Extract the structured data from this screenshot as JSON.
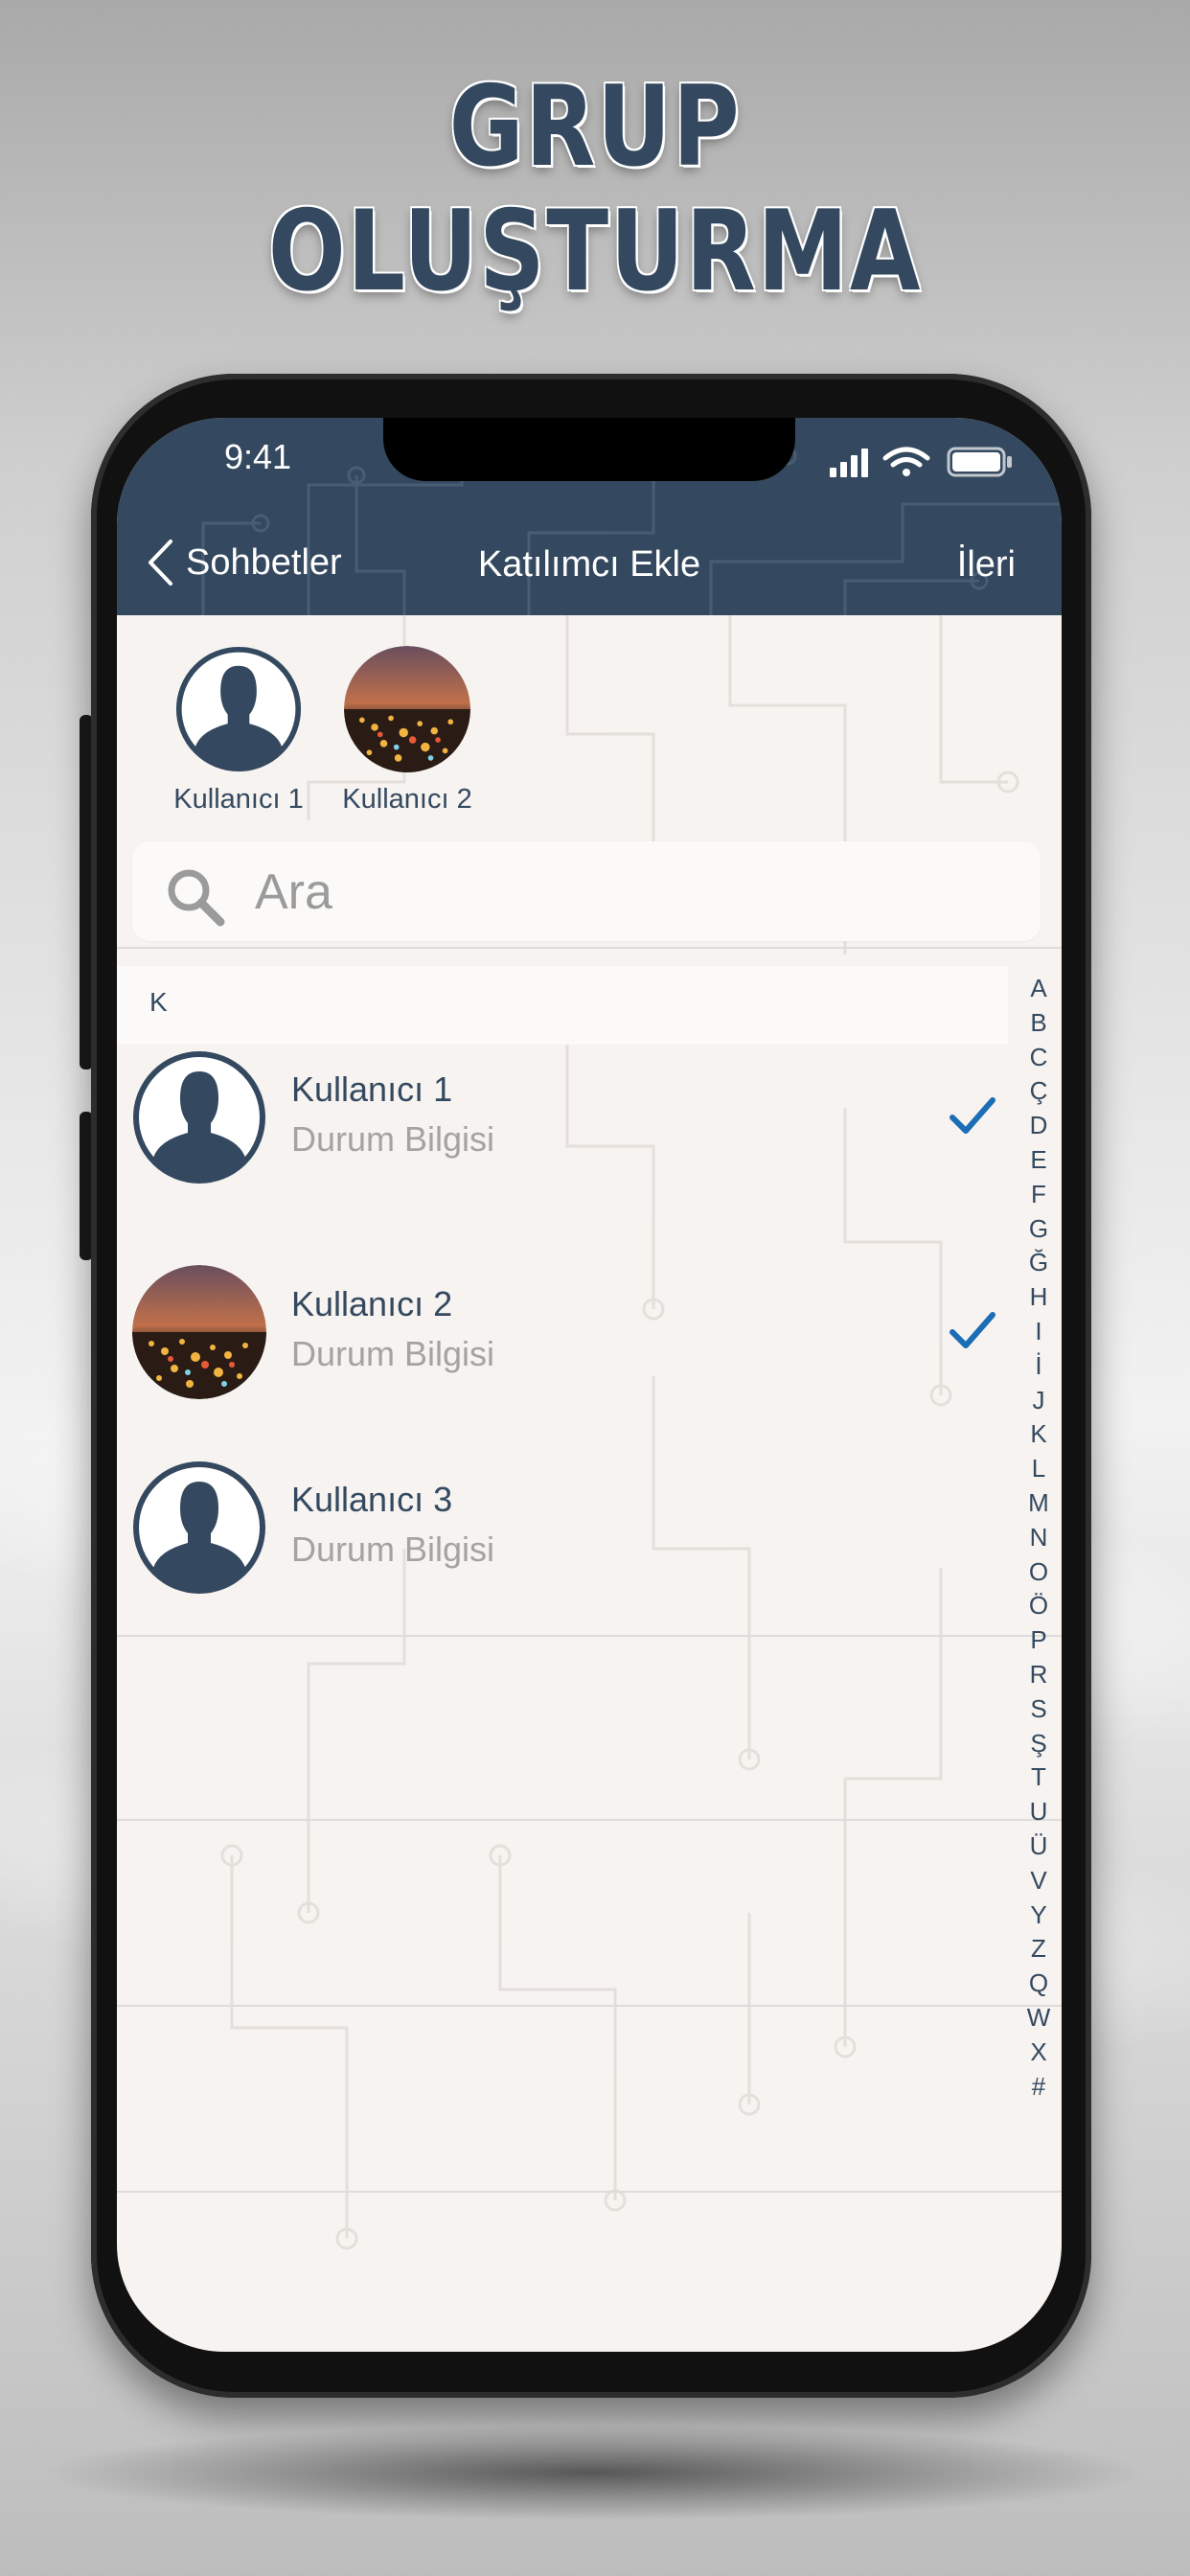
{
  "promo": {
    "title_line1": "GRUP",
    "title_line2": "OLUŞTURMA"
  },
  "status_bar": {
    "time": "9:41",
    "icons": [
      "signal-icon",
      "wifi-icon",
      "battery-icon"
    ]
  },
  "nav": {
    "back_label": "Sohbetler",
    "title": "Katılımcı Ekle",
    "next_label": "İleri"
  },
  "selected": [
    {
      "label": "Kullanıcı 1",
      "avatar": "silhouette"
    },
    {
      "label": "Kullanıcı 2",
      "avatar": "city-photo"
    }
  ],
  "search": {
    "placeholder": "Ara",
    "value": ""
  },
  "section": {
    "label": "K"
  },
  "contacts": [
    {
      "name": "Kullanıcı 1",
      "status": "Durum Bilgisi",
      "avatar": "silhouette",
      "checked": true
    },
    {
      "name": "Kullanıcı 2",
      "status": "Durum Bilgisi",
      "avatar": "city-photo",
      "checked": true
    },
    {
      "name": "Kullanıcı 3",
      "status": "Durum Bilgisi",
      "avatar": "silhouette",
      "checked": false
    }
  ],
  "index_letters": [
    "A",
    "B",
    "C",
    "Ç",
    "D",
    "E",
    "F",
    "G",
    "Ğ",
    "H",
    "I",
    "İ",
    "J",
    "K",
    "L",
    "M",
    "N",
    "O",
    "Ö",
    "P",
    "R",
    "S",
    "Ş",
    "T",
    "U",
    "Ü",
    "V",
    "Y",
    "Z",
    "Q",
    "W",
    "X",
    "#"
  ],
  "colors": {
    "navy": "#34495f",
    "accent_check": "#1b6db5",
    "background": "#f6f3f0",
    "secondary_text": "#a3a3a3"
  }
}
